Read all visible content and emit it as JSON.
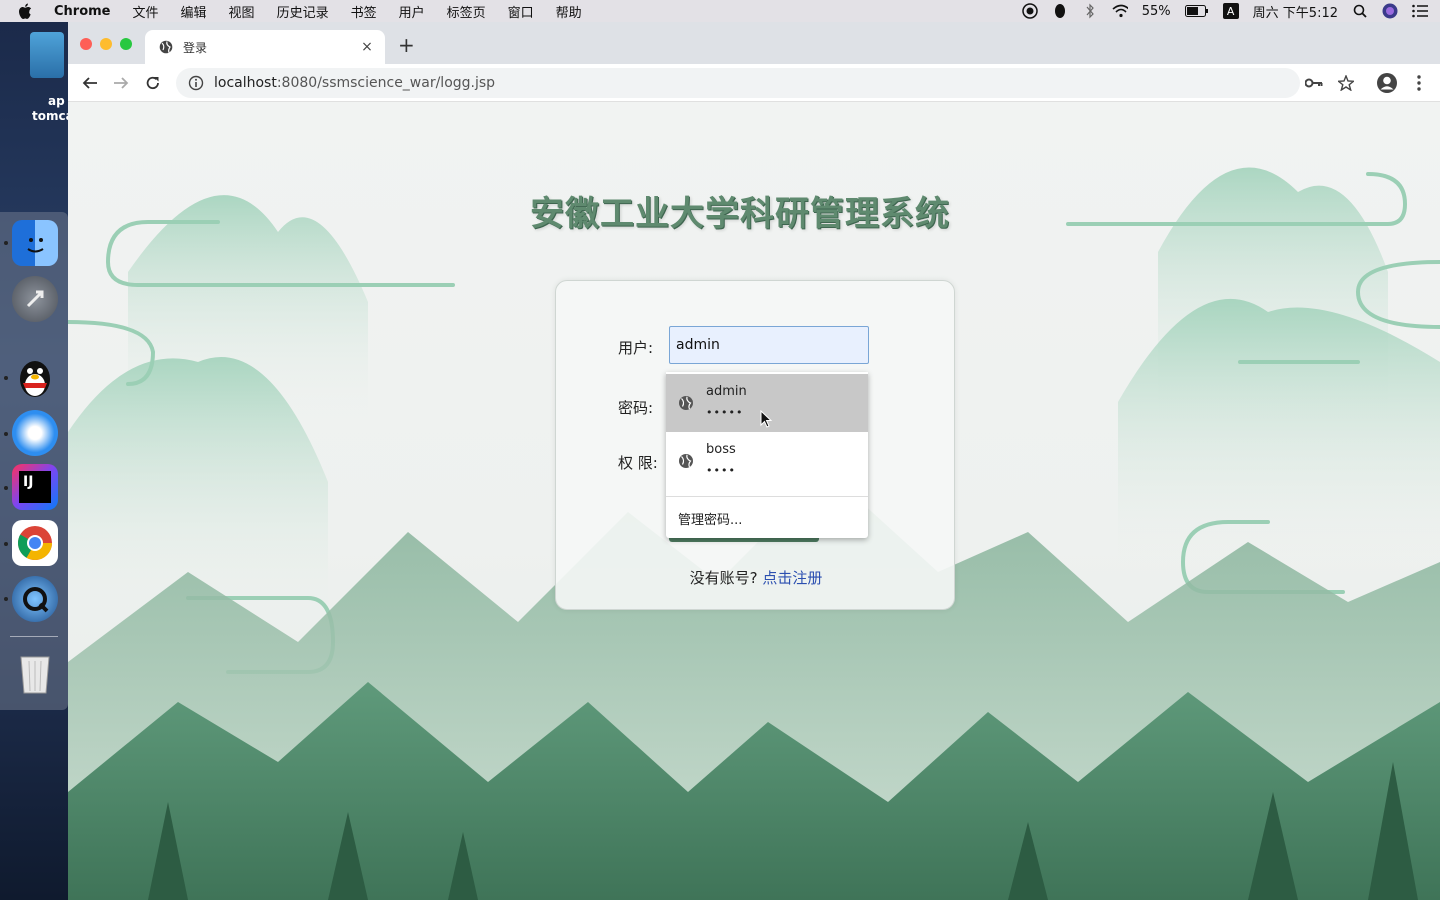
{
  "menubar": {
    "app_name": "Chrome",
    "items": [
      "文件",
      "编辑",
      "视图",
      "历史记录",
      "书签",
      "用户",
      "标签页",
      "窗口",
      "帮助"
    ],
    "battery": "55%",
    "input_method": "A",
    "clock": "周六 下午5:12"
  },
  "desktop": {
    "label_line1": "ap",
    "label_line2": "tomca"
  },
  "browser": {
    "tab_title": "登录",
    "new_tab": "+",
    "tab_close": "×",
    "url_host": "localhost",
    "url_rest": ":8080/ssmscience_war/logg.jsp"
  },
  "page": {
    "title": "安徽工业大学科研管理系统",
    "user_label": "用户:",
    "password_label": "密码:",
    "permission_label": "权 限:",
    "username_value": "admin",
    "register_prompt": "没有账号?",
    "register_link": "点击注册"
  },
  "autofill": {
    "suggestions": [
      {
        "username": "admin",
        "password_mask": "•••••"
      },
      {
        "username": "boss",
        "password_mask": "••••"
      }
    ],
    "manage": "管理密码..."
  },
  "colors": {
    "title_green": "#5f8a6f",
    "link_blue": "#2b4fb0",
    "button_green": "#4f7d62"
  }
}
